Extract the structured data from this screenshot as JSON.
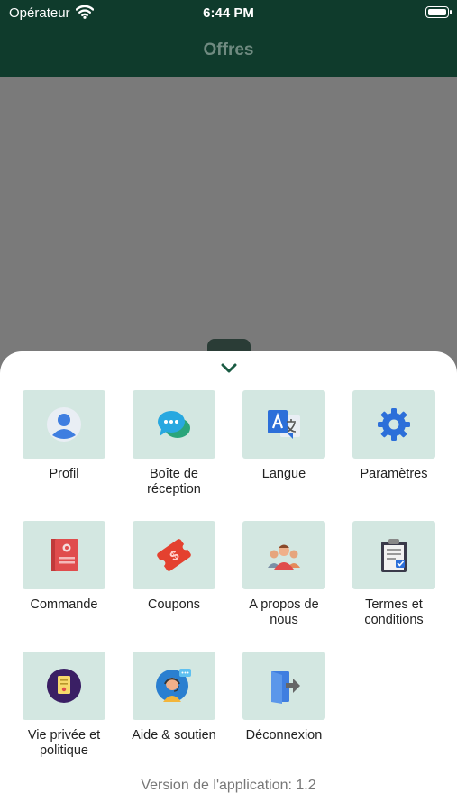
{
  "status_bar": {
    "carrier": "Opérateur",
    "time": "6:44 PM"
  },
  "header": {
    "title": "Offres"
  },
  "menu": {
    "items": [
      {
        "label": "Profil",
        "icon": "profile-icon"
      },
      {
        "label": "Boîte de\nréception",
        "icon": "inbox-chat-icon"
      },
      {
        "label": "Langue",
        "icon": "translate-icon"
      },
      {
        "label": "Paramètres",
        "icon": "gear-icon"
      },
      {
        "label": "Commande",
        "icon": "order-book-icon"
      },
      {
        "label": "Coupons",
        "icon": "coupon-icon"
      },
      {
        "label": "A propos de\nnous",
        "icon": "team-icon"
      },
      {
        "label": "Termes et\nconditions",
        "icon": "terms-clipboard-icon"
      },
      {
        "label": "Vie privée et\npolitique",
        "icon": "privacy-policy-icon"
      },
      {
        "label": "Aide & soutien",
        "icon": "support-agent-icon"
      },
      {
        "label": "Déconnexion",
        "icon": "logout-door-icon"
      }
    ]
  },
  "version": "Version de l'application: 1.2"
}
